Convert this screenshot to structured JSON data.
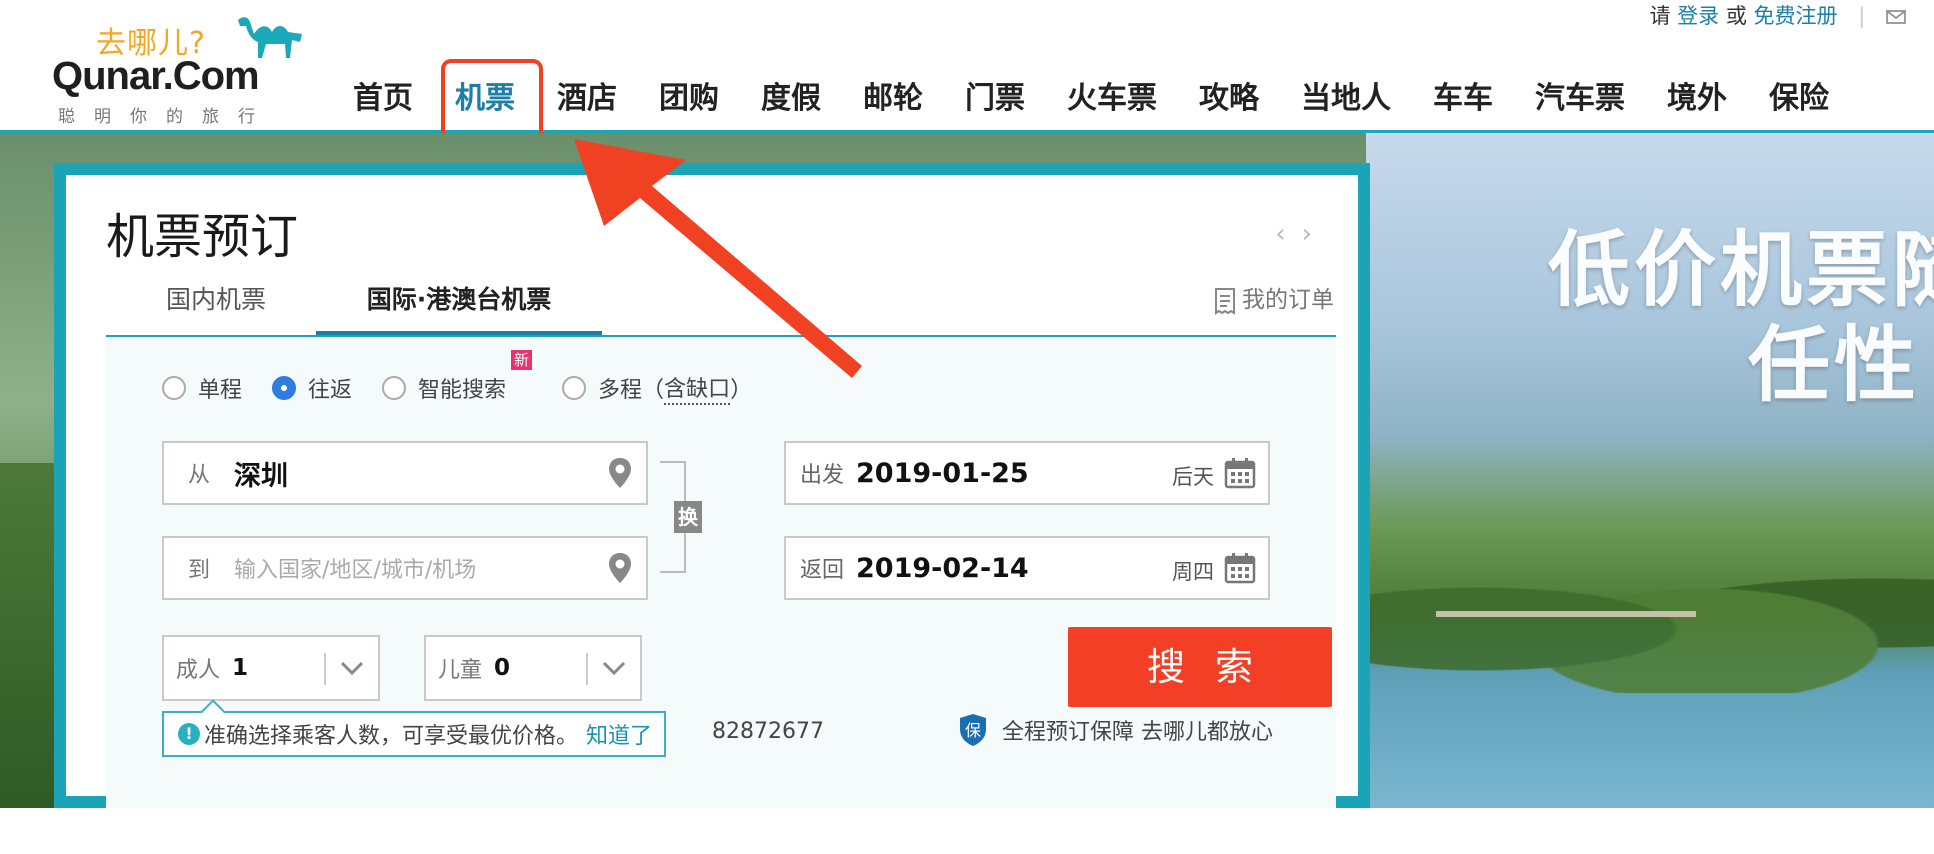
{
  "header": {
    "logo_top": "去哪儿?",
    "logo_main": "Qunar.Com",
    "logo_slogan": "聪明你的旅行",
    "nav": [
      {
        "label": "首页"
      },
      {
        "label": "机票"
      },
      {
        "label": "酒店"
      },
      {
        "label": "团购"
      },
      {
        "label": "度假"
      },
      {
        "label": "邮轮"
      },
      {
        "label": "门票"
      },
      {
        "label": "火车票"
      },
      {
        "label": "攻略"
      },
      {
        "label": "当地人"
      },
      {
        "label": "车车"
      },
      {
        "label": "汽车票"
      },
      {
        "label": "境外"
      },
      {
        "label": "保险"
      }
    ],
    "top_links": {
      "please": "请",
      "login": "登录",
      "or": "或",
      "register": "免费注册"
    }
  },
  "banner": {
    "slogan_line1": "低价机票随",
    "slogan_line2": "任性"
  },
  "panel": {
    "title": "机票预订",
    "tabs": [
      {
        "label": "国内机票"
      },
      {
        "label": "国际·港澳台机票"
      }
    ],
    "my_orders": "我的订单",
    "trip_types": [
      {
        "label": "单程",
        "checked": false
      },
      {
        "label": "往返",
        "checked": true
      },
      {
        "label": "智能搜索",
        "checked": false,
        "badge": "新"
      },
      {
        "label_prefix": "多程（",
        "label_dotted": "含缺口",
        "label_suffix": "）",
        "checked": false
      }
    ],
    "from": {
      "label": "从",
      "value": "深圳"
    },
    "to": {
      "label": "到",
      "placeholder": "输入国家/地区/城市/机场"
    },
    "swap_label": "换",
    "depart": {
      "label": "出发",
      "value": "2019-01-25",
      "day": "后天"
    },
    "return": {
      "label": "返回",
      "value": "2019-02-14",
      "day": "周四"
    },
    "adults": {
      "label": "成人",
      "value": "1"
    },
    "children": {
      "label": "儿童",
      "value": "0"
    },
    "search_label": "搜索",
    "tip": {
      "text": "准确选择乘客人数，可享受最优价格。",
      "dismiss": "知道了"
    },
    "phone_partial": "82872677",
    "guarantee": {
      "icon_text": "保",
      "text": "全程预订保障 去哪儿都放心"
    }
  },
  "colors": {
    "accent": "#1ba3b6",
    "link": "#1b7fa8",
    "search_button": "#f33f26",
    "annotation_red": "#f04222"
  }
}
